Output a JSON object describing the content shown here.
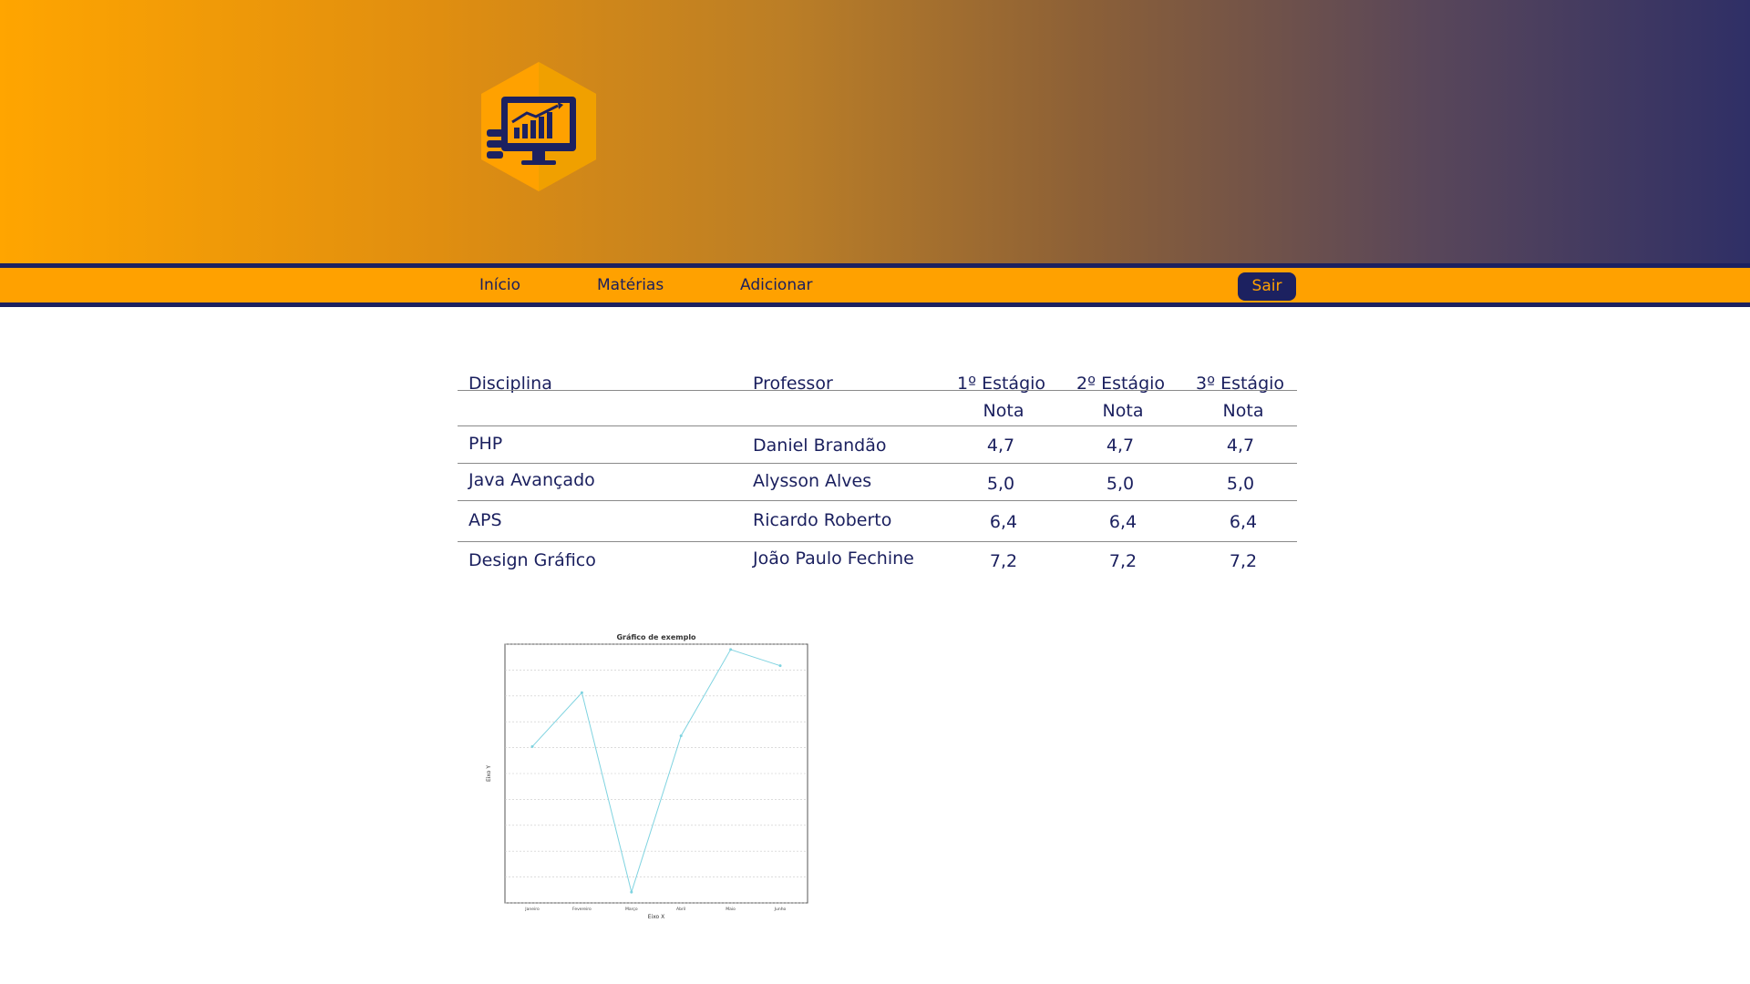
{
  "nav": {
    "items": [
      "Início",
      "Matérias",
      "Adicionar"
    ],
    "logout_label": "Sair"
  },
  "grades_table": {
    "headers": {
      "discipline": "Disciplina",
      "professor": "Professor",
      "stage1": "1º Estágio",
      "stage2": "2º Estágio",
      "stage3": "3º Estágio",
      "grade_sub": "Nota"
    },
    "rows": [
      {
        "discipline": "PHP",
        "professor": "Daniel Brandão",
        "grades": [
          "4,7",
          "4,7",
          "4,7"
        ]
      },
      {
        "discipline": "Java Avançado",
        "professor": "Alysson Alves",
        "grades": [
          "5,0",
          "5,0",
          "5,0"
        ]
      },
      {
        "discipline": "APS",
        "professor": "Ricardo Roberto",
        "grades": [
          "6,4",
          "6,4",
          "6,4"
        ]
      },
      {
        "discipline": "Design Gráfico",
        "professor": "João Paulo Fechine",
        "grades": [
          "7,2",
          "7,2",
          "7,2"
        ]
      }
    ]
  },
  "colors": {
    "navy": "#1c2160",
    "orange": "#ffa100",
    "line_series": "#7fd3e0"
  },
  "chart_data": {
    "type": "line",
    "title": "Gráfico de exemplo",
    "xlabel": "Eixo X",
    "ylabel": "Eixo Y",
    "x_ticks": [
      "Janeiro",
      "Fevereiro",
      "Março",
      "Abril",
      "Maio",
      "Junho"
    ],
    "values": [
      4.45,
      4.95,
      3.1,
      4.55,
      5.35,
      5.2
    ],
    "ylim": [
      3,
      5.4
    ],
    "grid": true
  }
}
